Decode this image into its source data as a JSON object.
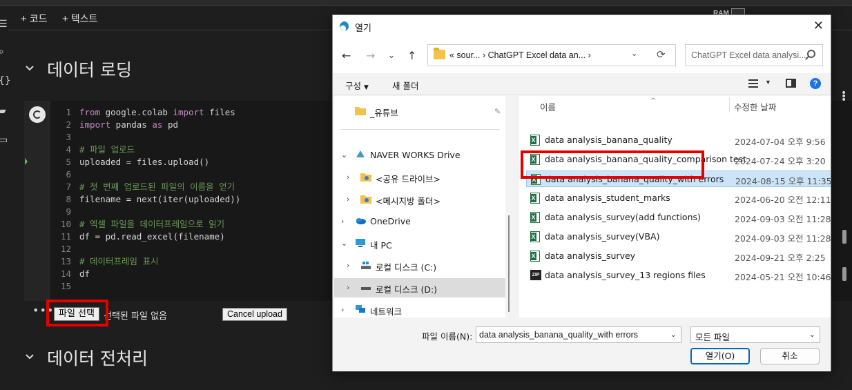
{
  "toolbar": {
    "add_code": "코드",
    "add_text": "텍스트",
    "ram_label": "RAM"
  },
  "sections": {
    "loading": "데이터 로딩",
    "preprocessing": "데이터 전처리"
  },
  "code_lines": [
    {
      "n": "1",
      "parts": [
        [
          "kw",
          "from"
        ],
        [
          "tx",
          " google.colab "
        ],
        [
          "kw",
          "import"
        ],
        [
          "tx",
          " files"
        ]
      ]
    },
    {
      "n": "2",
      "parts": [
        [
          "kw",
          "import"
        ],
        [
          "tx",
          " pandas "
        ],
        [
          "kw",
          "as"
        ],
        [
          "tx",
          " pd"
        ]
      ]
    },
    {
      "n": "3",
      "parts": []
    },
    {
      "n": "4",
      "parts": [
        [
          "cm",
          "# 파일 업로드"
        ]
      ]
    },
    {
      "n": "5",
      "parts": [
        [
          "tx",
          "uploaded = files.upload()"
        ]
      ]
    },
    {
      "n": "6",
      "parts": []
    },
    {
      "n": "7",
      "parts": [
        [
          "cm",
          "# 첫 번째 업로드된 파일의 이름을 얻기"
        ]
      ]
    },
    {
      "n": "8",
      "parts": [
        [
          "tx",
          "filename = next(iter(uploaded))"
        ]
      ]
    },
    {
      "n": "9",
      "parts": []
    },
    {
      "n": "10",
      "parts": [
        [
          "cm",
          "# 엑셀 파일을 데이터프레임으로 읽기"
        ]
      ]
    },
    {
      "n": "11",
      "parts": [
        [
          "tx",
          "df = pd.read_excel(filename)"
        ]
      ]
    },
    {
      "n": "12",
      "parts": []
    },
    {
      "n": "13",
      "parts": [
        [
          "cm",
          "# 데이터프레임 표시"
        ]
      ]
    },
    {
      "n": "14",
      "parts": [
        [
          "tx",
          "df"
        ]
      ]
    },
    {
      "n": "15",
      "parts": []
    }
  ],
  "output": {
    "choose_file": "파일 선택",
    "no_file": "선택된 파일 없음",
    "cancel_upload": "Cancel upload"
  },
  "dialog": {
    "title": "열기",
    "address": "«  sour...  ›  ChatGPT Excel data an...  ›",
    "search_placeholder": "ChatGPT Excel data analysi...",
    "organize": "구성",
    "new_folder": "새 폴더",
    "help": "?",
    "nav": [
      {
        "label": "_유튜브",
        "indent": 30,
        "chev": "",
        "icon": "folder",
        "pin": true
      },
      {
        "label": "NAVER WORKS Drive",
        "indent": 30,
        "chev": "⌄",
        "icon": "drive"
      },
      {
        "label": "<공유 드라이브>",
        "indent": 38,
        "chev": "›",
        "icon": "share"
      },
      {
        "label": "<메시지방 폴더>",
        "indent": 38,
        "chev": "›",
        "icon": "share"
      },
      {
        "label": "OneDrive",
        "indent": 30,
        "chev": "›",
        "icon": "cloud"
      },
      {
        "label": "내 PC",
        "indent": 30,
        "chev": "⌄",
        "icon": "pc"
      },
      {
        "label": "로컬 디스크 (C:)",
        "indent": 38,
        "chev": "›",
        "icon": "diskc"
      },
      {
        "label": "로컬 디스크 (D:)",
        "indent": 38,
        "chev": "›",
        "icon": "disk",
        "selected": true
      },
      {
        "label": "네트워크",
        "indent": 30,
        "chev": "›",
        "icon": "network"
      }
    ],
    "columns": {
      "name": "이름",
      "modified": "수정한 날짜",
      "sort_caret": "^"
    },
    "files": [
      {
        "name": "data analysis_banana_quality",
        "date": "2024-07-04 오후 9:56",
        "icon": "xls"
      },
      {
        "name": "data analysis_banana_quality_comparison test",
        "date": "2024-07-24 오후 3:20",
        "icon": "xls"
      },
      {
        "name": "data analysis_banana_quality_with errors",
        "date": "2024-08-15 오후 11:35",
        "icon": "xls",
        "selected": true
      },
      {
        "name": "data analysis_student_marks",
        "date": "2024-06-20 오전 12:11",
        "icon": "xls"
      },
      {
        "name": "data analysis_survey(add functions)",
        "date": "2024-09-03 오전 11:28",
        "icon": "xls"
      },
      {
        "name": "data analysis_survey(VBA)",
        "date": "2024-09-03 오전 11:28",
        "icon": "xls"
      },
      {
        "name": "data analysis_survey",
        "date": "2024-09-21 오후 2:25",
        "icon": "xls"
      },
      {
        "name": "data analysis_survey_13 regions files",
        "date": "2024-05-21 오전 10:46",
        "icon": "zip"
      }
    ],
    "filename_label": "파일 이름(N):",
    "filename_value": "data analysis_banana_quality_with errors",
    "file_type": "모든 파일",
    "open_button": "열기(O)",
    "cancel_button": "취소"
  },
  "colors": {
    "highlight": "#e50000",
    "selection": "#cce4f7",
    "accent": "#0067c0"
  }
}
